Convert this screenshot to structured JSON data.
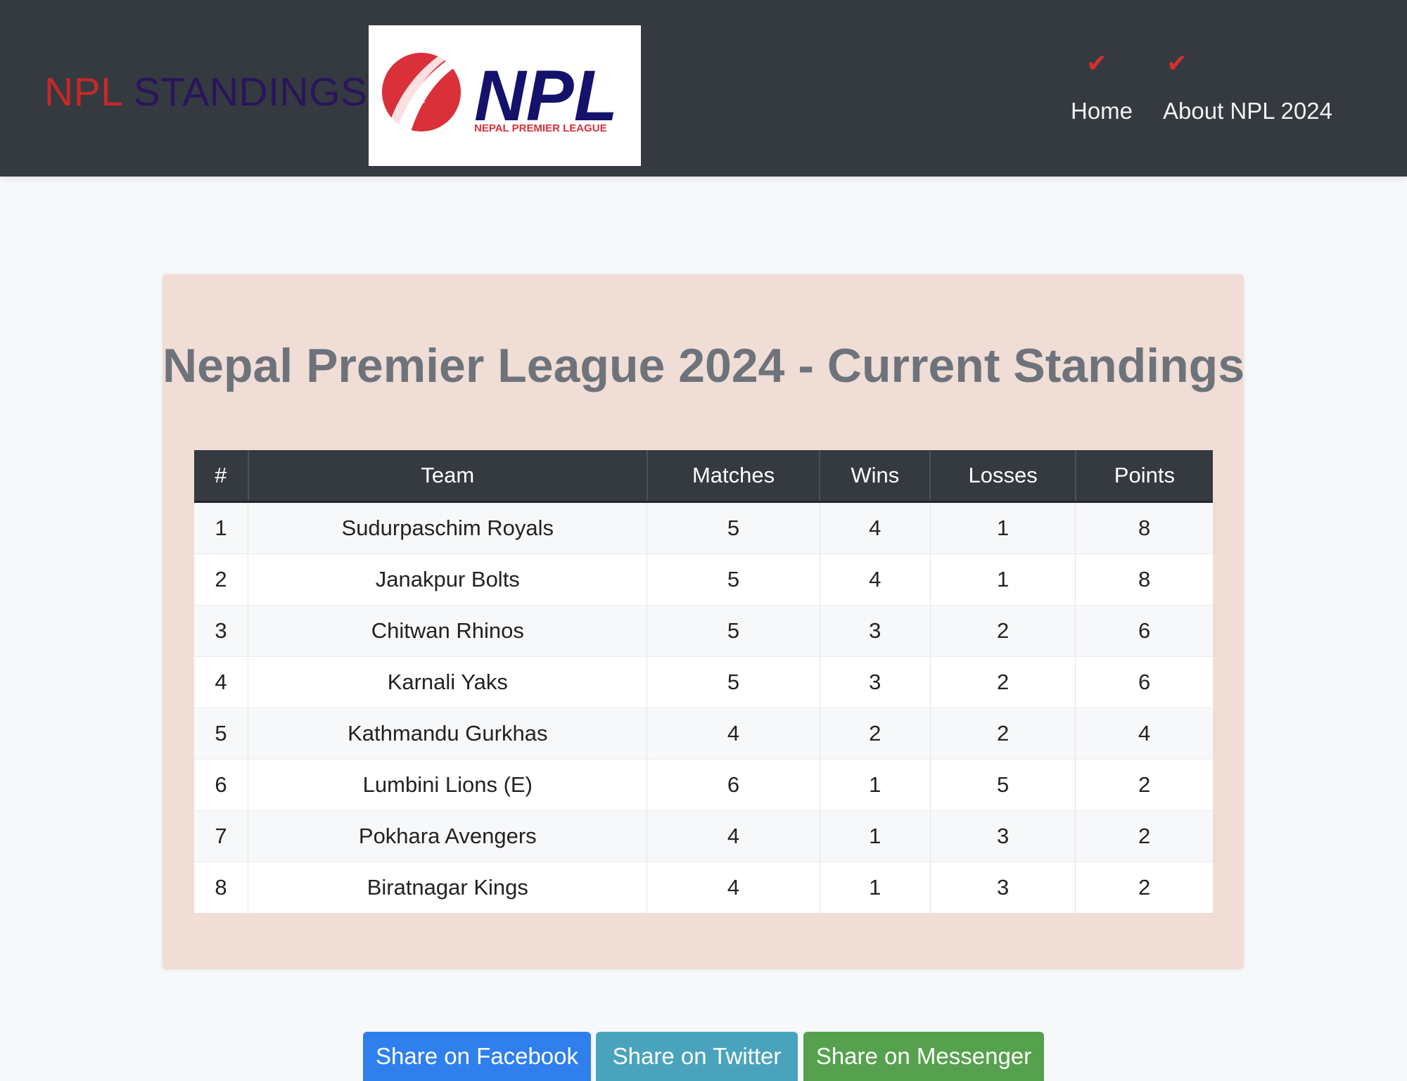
{
  "navbar": {
    "brand_part1": "NPL",
    "brand_part2": "STANDINGS",
    "logo": {
      "wordmark": "NPL",
      "subtitle": "NEPAL PREMIER LEAGUE"
    },
    "links": [
      {
        "label": "Home",
        "icon": "check-icon"
      },
      {
        "label": "About NPL 2024",
        "icon": "check-icon"
      }
    ]
  },
  "main": {
    "title": "Nepal Premier League 2024 - Current Standings",
    "table": {
      "headers": [
        "#",
        "Team",
        "Matches",
        "Wins",
        "Losses",
        "Points"
      ],
      "rows": [
        {
          "rank": "1",
          "team": "Sudurpaschim Royals",
          "matches": "5",
          "wins": "4",
          "losses": "1",
          "points": "8"
        },
        {
          "rank": "2",
          "team": "Janakpur Bolts",
          "matches": "5",
          "wins": "4",
          "losses": "1",
          "points": "8"
        },
        {
          "rank": "3",
          "team": "Chitwan Rhinos",
          "matches": "5",
          "wins": "3",
          "losses": "2",
          "points": "6"
        },
        {
          "rank": "4",
          "team": "Karnali Yaks",
          "matches": "5",
          "wins": "3",
          "losses": "2",
          "points": "6"
        },
        {
          "rank": "5",
          "team": "Kathmandu Gurkhas",
          "matches": "4",
          "wins": "2",
          "losses": "2",
          "points": "4"
        },
        {
          "rank": "6",
          "team": "Lumbini Lions (E)",
          "matches": "6",
          "wins": "1",
          "losses": "5",
          "points": "2"
        },
        {
          "rank": "7",
          "team": "Pokhara Avengers",
          "matches": "4",
          "wins": "1",
          "losses": "3",
          "points": "2"
        },
        {
          "rank": "8",
          "team": "Biratnagar Kings",
          "matches": "4",
          "wins": "1",
          "losses": "3",
          "points": "2"
        }
      ]
    }
  },
  "share": {
    "facebook": "Share on Facebook",
    "twitter": "Share on Twitter",
    "messenger": "Share on Messenger"
  },
  "colors": {
    "navbar_bg": "#343a40",
    "brand_red": "#c62828",
    "brand_navy": "#2a145c",
    "card_bg": "#efddd6",
    "facebook": "#2f80ed",
    "twitter": "#4aa3bd",
    "messenger": "#56a14d"
  }
}
